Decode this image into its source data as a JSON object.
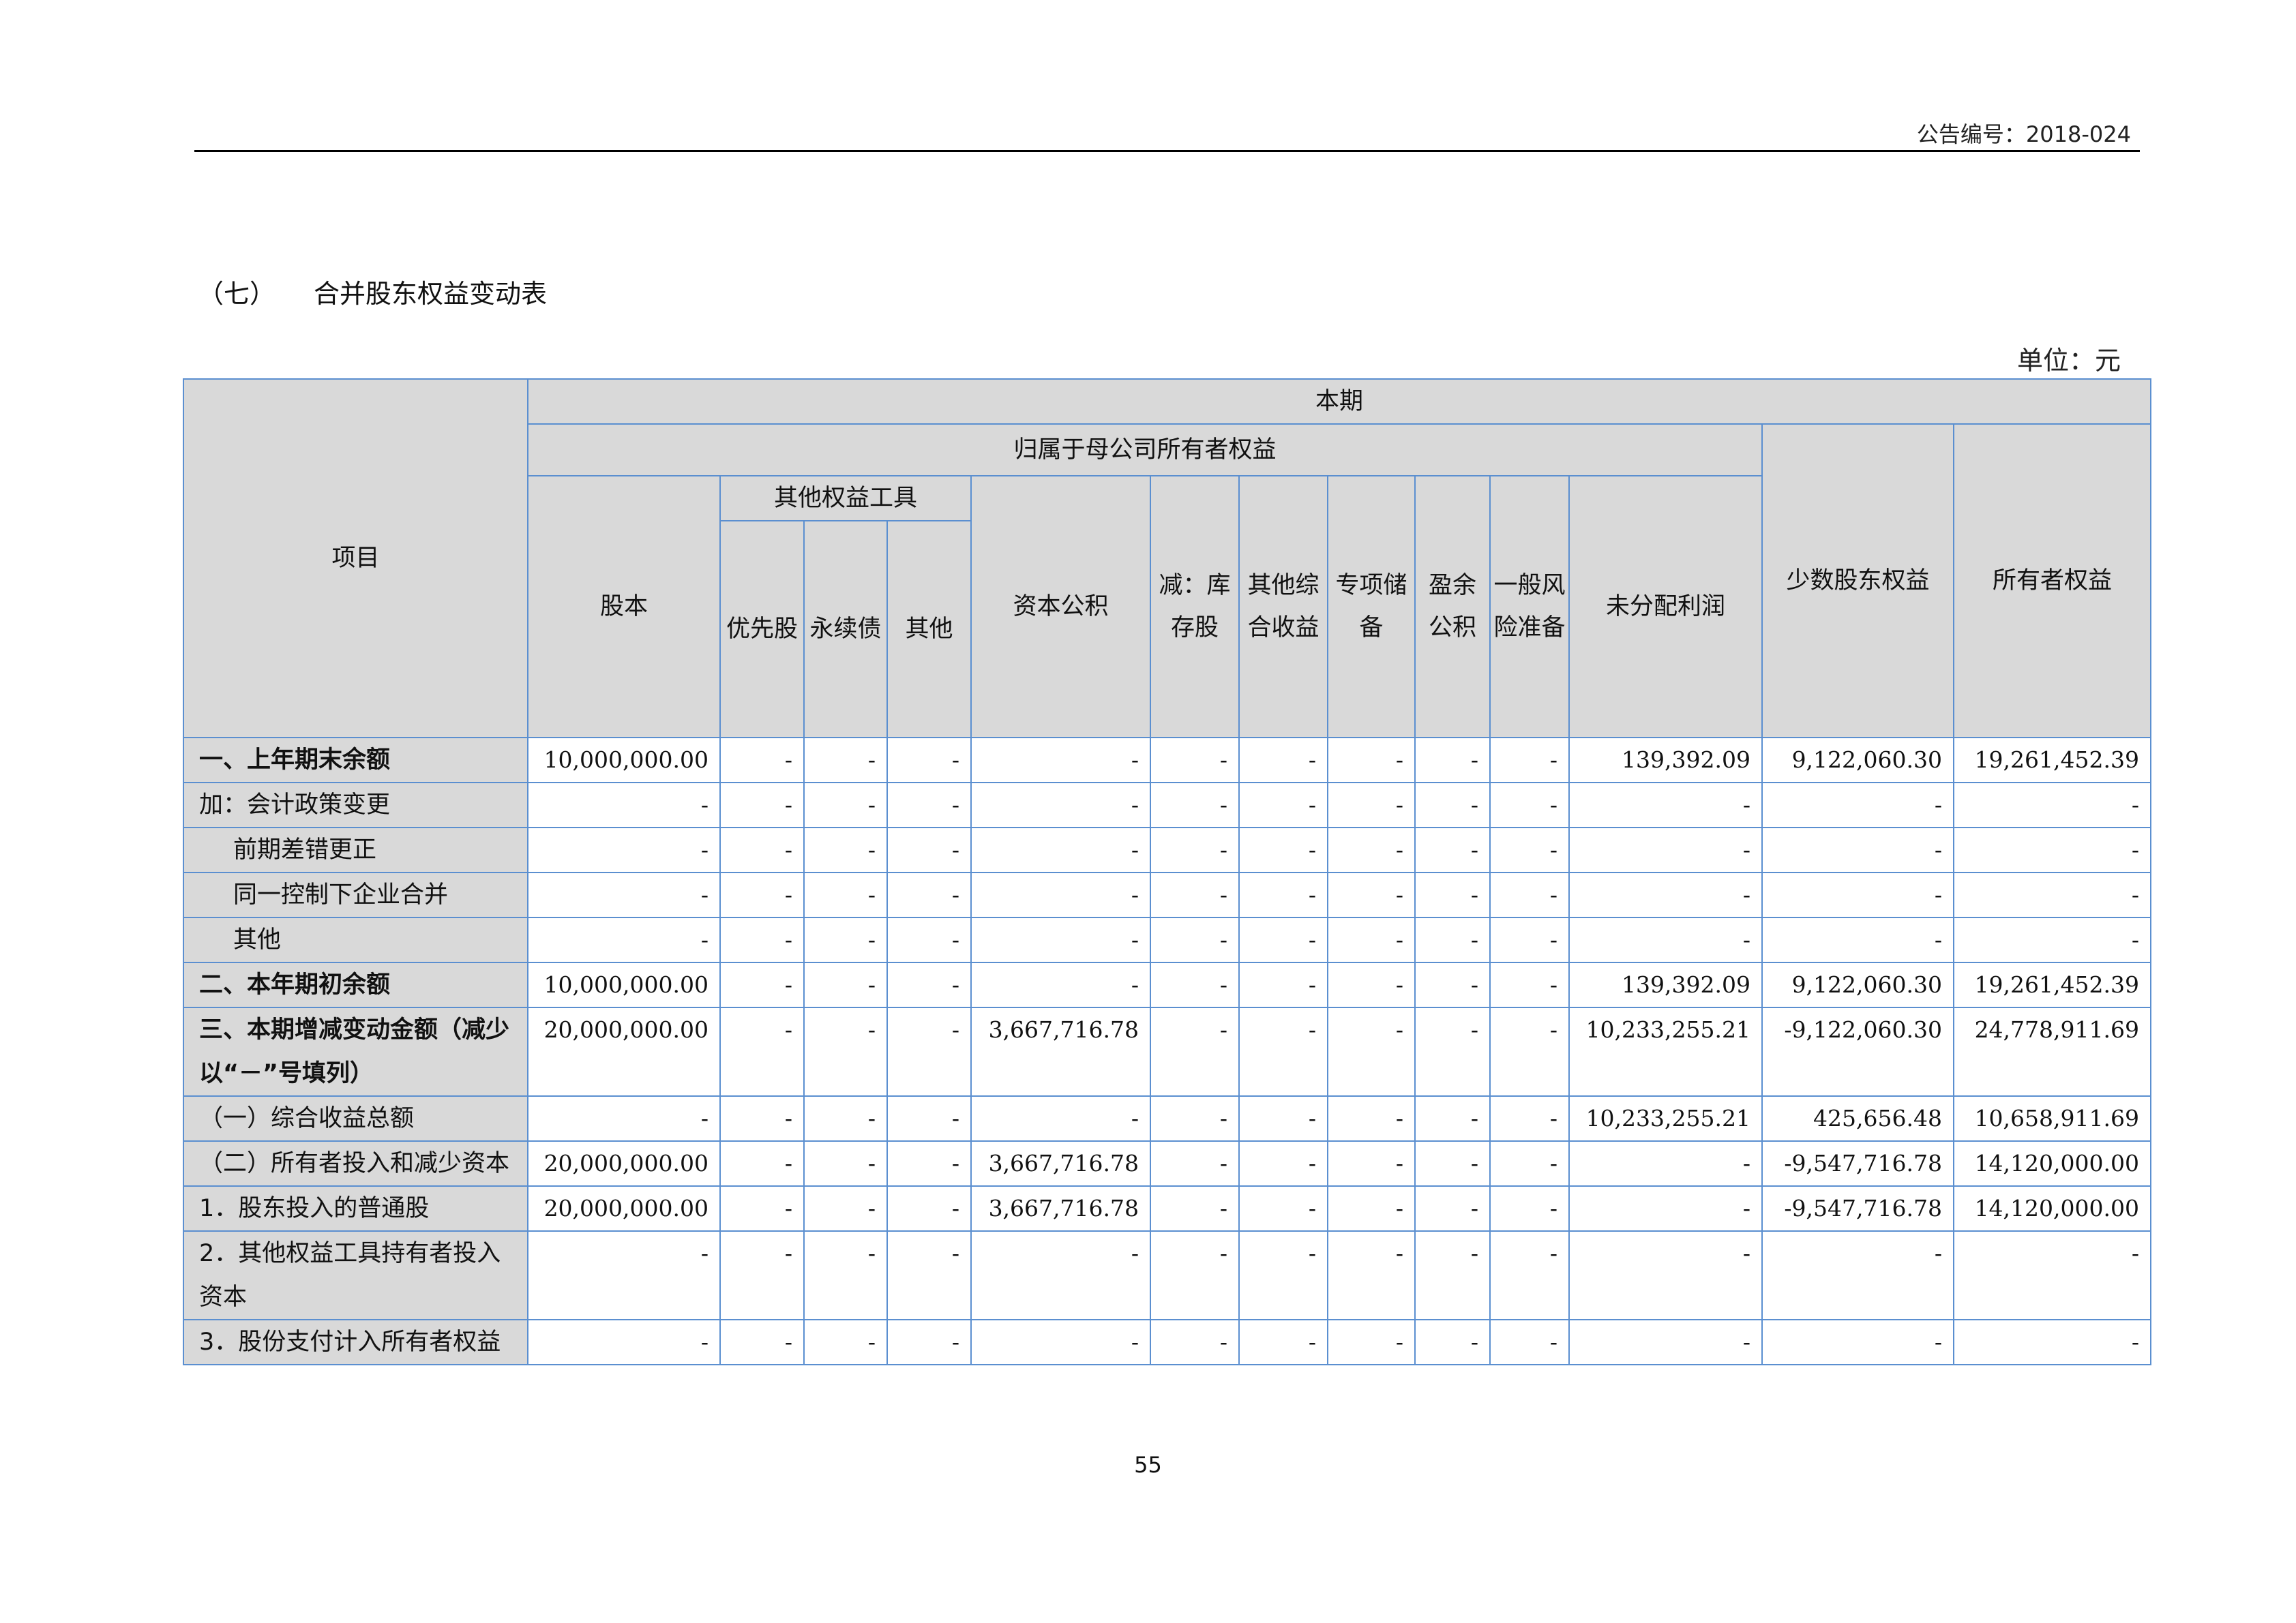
{
  "header": {
    "announcement_no": "公告编号：2018-024"
  },
  "section": {
    "number": "（七）",
    "title": "合并股东权益变动表"
  },
  "unit": "单位：元",
  "table": {
    "h_item": "项目",
    "h_current": "本期",
    "h_parent": "归属于母公司所有者权益",
    "h_other_tools": "其他权益工具",
    "h_minority": "少数股东权益",
    "h_total": "所有者权益",
    "h_capital": "股本",
    "h_preferred": "优先股",
    "h_perpetual": "永续债",
    "h_other": "其他",
    "h_reserve": "资本公积",
    "h_treasury": "减：库存股",
    "h_oci": "其他综合收益",
    "h_special": "专项储备",
    "h_surplus": "盈余公积",
    "h_risk": "一般风险准备",
    "h_retained": "未分配利润",
    "rows": [
      {
        "label": "一、上年期末余额",
        "cells": [
          "10,000,000.00",
          "-",
          "-",
          "-",
          "-",
          "-",
          "-",
          "-",
          "-",
          "-",
          "139,392.09",
          "9,122,060.30",
          "19,261,452.39"
        ]
      },
      {
        "label": "加：会计政策变更",
        "cells": [
          "-",
          "-",
          "-",
          "-",
          "-",
          "-",
          "-",
          "-",
          "-",
          "-",
          "-",
          "-",
          "-"
        ]
      },
      {
        "label": "前期差错更正",
        "cells": [
          "-",
          "-",
          "-",
          "-",
          "-",
          "-",
          "-",
          "-",
          "-",
          "-",
          "-",
          "-",
          "-"
        ]
      },
      {
        "label": "同一控制下企业合并",
        "cells": [
          "-",
          "-",
          "-",
          "-",
          "-",
          "-",
          "-",
          "-",
          "-",
          "-",
          "-",
          "-",
          "-"
        ]
      },
      {
        "label": "其他",
        "cells": [
          "-",
          "-",
          "-",
          "-",
          "-",
          "-",
          "-",
          "-",
          "-",
          "-",
          "-",
          "-",
          "-"
        ]
      },
      {
        "label": "二、本年期初余额",
        "cells": [
          "10,000,000.00",
          "-",
          "-",
          "-",
          "-",
          "-",
          "-",
          "-",
          "-",
          "-",
          "139,392.09",
          "9,122,060.30",
          "19,261,452.39"
        ]
      },
      {
        "label": "三、本期增减变动金额（减少以“－”号填列）",
        "cells": [
          "20,000,000.00",
          "-",
          "-",
          "-",
          "3,667,716.78",
          "-",
          "-",
          "-",
          "-",
          "-",
          "10,233,255.21",
          "-9,122,060.30",
          "24,778,911.69"
        ]
      },
      {
        "label": "（一）综合收益总额",
        "cells": [
          "-",
          "-",
          "-",
          "-",
          "-",
          "-",
          "-",
          "-",
          "-",
          "-",
          "10,233,255.21",
          "425,656.48",
          "10,658,911.69"
        ]
      },
      {
        "label": "（二）所有者投入和减少资本",
        "cells": [
          "20,000,000.00",
          "-",
          "-",
          "-",
          "3,667,716.78",
          "-",
          "-",
          "-",
          "-",
          "-",
          "-",
          "-9,547,716.78",
          "14,120,000.00"
        ]
      },
      {
        "label": "1．股东投入的普通股",
        "cells": [
          "20,000,000.00",
          "-",
          "-",
          "-",
          "3,667,716.78",
          "-",
          "-",
          "-",
          "-",
          "-",
          "-",
          "-9,547,716.78",
          "14,120,000.00"
        ]
      },
      {
        "label": "2．其他权益工具持有者投入资本",
        "cells": [
          "-",
          "-",
          "-",
          "-",
          "-",
          "-",
          "-",
          "-",
          "-",
          "-",
          "-",
          "-",
          "-"
        ]
      },
      {
        "label": "3．股份支付计入所有者权益",
        "cells": [
          "-",
          "-",
          "-",
          "-",
          "-",
          "-",
          "-",
          "-",
          "-",
          "-",
          "-",
          "-",
          "-"
        ]
      }
    ]
  },
  "page_number": "55"
}
